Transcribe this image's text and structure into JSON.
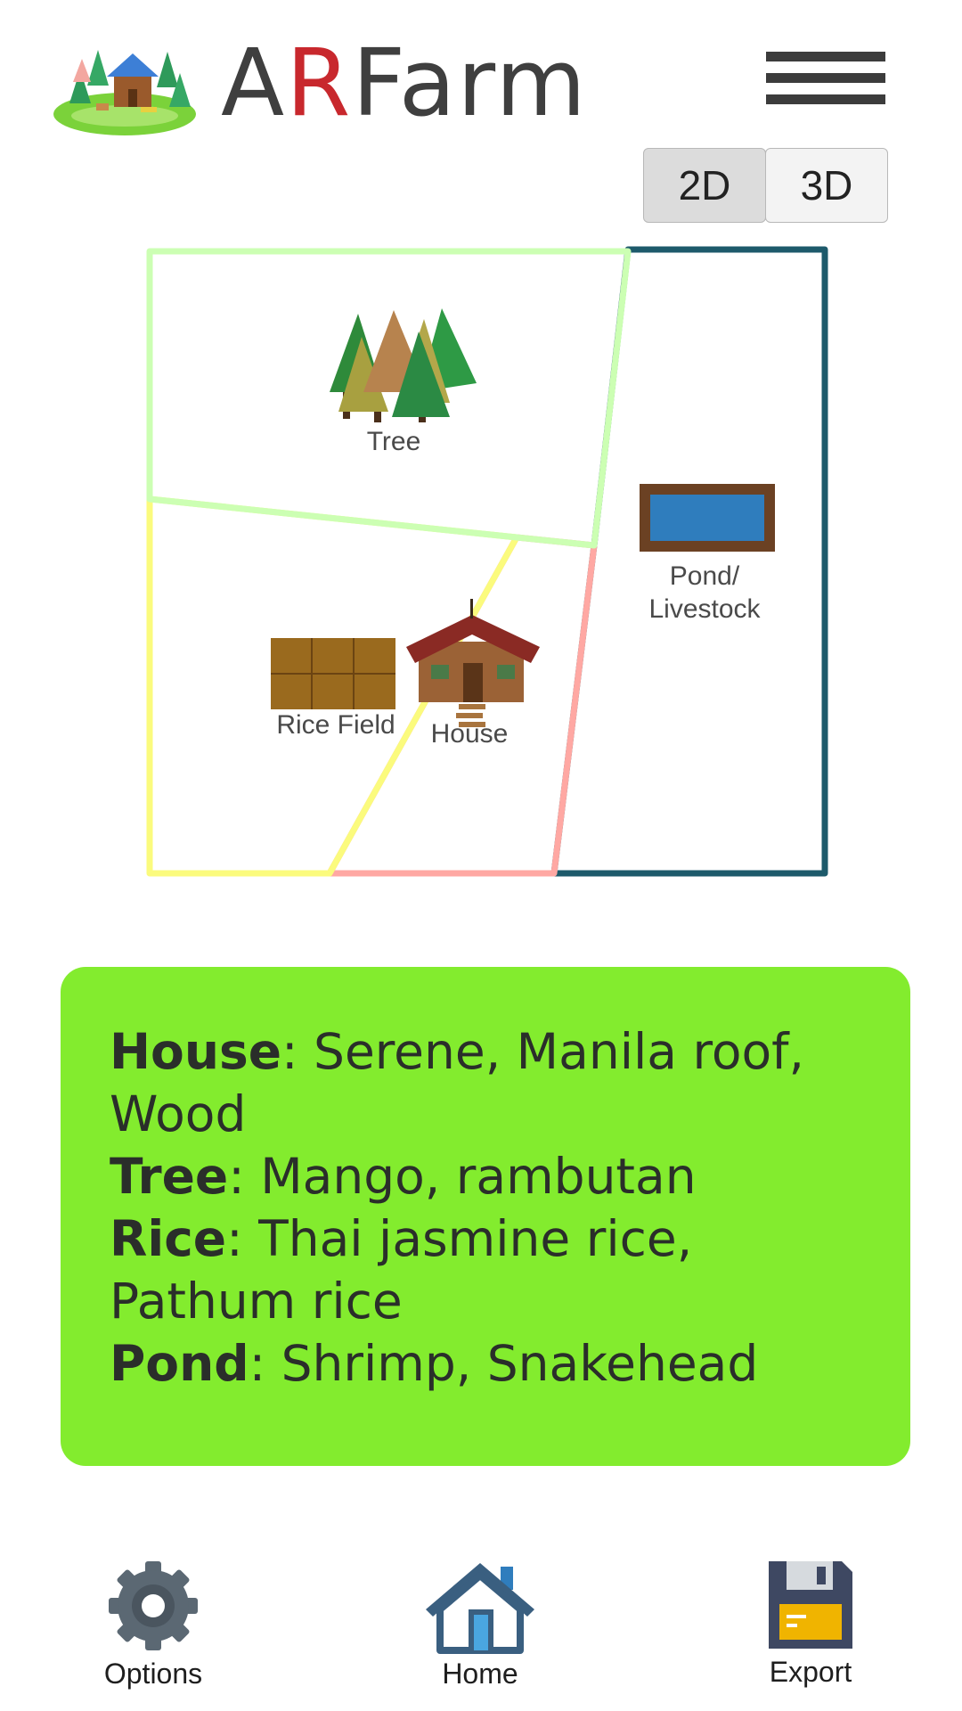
{
  "header": {
    "title_prefix": "A",
    "title_accent": "R",
    "title_suffix": "Farm",
    "logo_icon": "farm-island-logo",
    "menu_icon": "hamburger-menu-icon"
  },
  "view_toggle": {
    "options": [
      "2D",
      "3D"
    ],
    "selected": "2D"
  },
  "map": {
    "zones": [
      {
        "name": "Tree",
        "color": "#ccffb3"
      },
      {
        "name": "Rice Field",
        "color": "#fbfb7d"
      },
      {
        "name": "House",
        "color": "#ffa8a3"
      },
      {
        "name": "Pond/Livestock",
        "color": "#1d5a6b"
      }
    ],
    "labels": {
      "tree": "Tree",
      "pond_line1": "Pond/",
      "pond_line2": "Livestock",
      "rice": "Rice Field",
      "house": "House"
    }
  },
  "info_card": {
    "background": "#83ec2e",
    "house_key": "House",
    "house_value_1": ": Serene, Manila roof,",
    "house_value_2": "Wood",
    "tree_key": "Tree",
    "tree_value": ": Mango, rambutan",
    "rice_key": "Rice",
    "rice_value_1": ": Thai jasmine rice,",
    "rice_value_2": "Pathum rice",
    "pond_key": "Pond",
    "pond_value": ": Shrimp, Snakehead"
  },
  "bottom_nav": {
    "options_label": "Options",
    "home_label": "Home",
    "export_label": "Export"
  }
}
